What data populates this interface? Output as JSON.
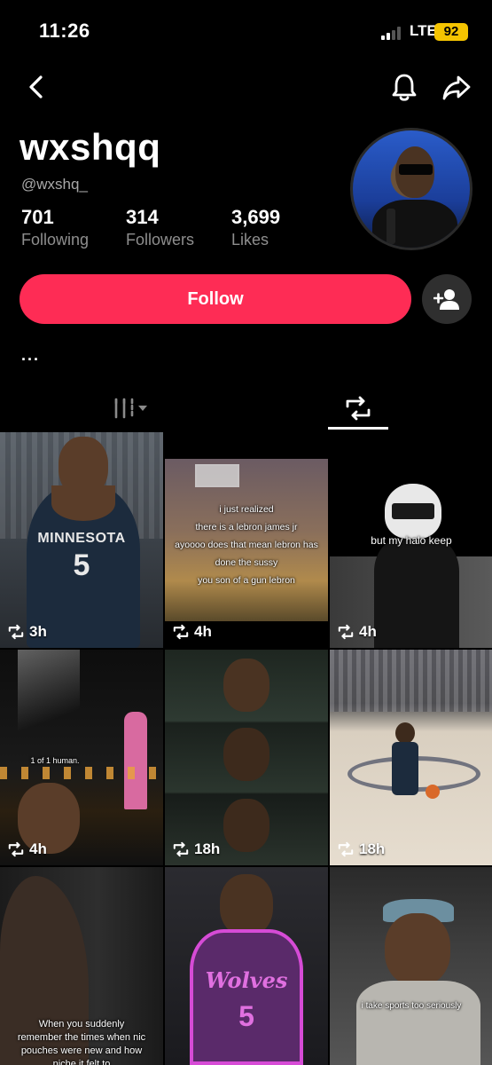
{
  "status_bar": {
    "time": "11:26",
    "network": "LTE",
    "battery": "92"
  },
  "profile": {
    "display_name": "wxshqq",
    "username": "@wxshq_",
    "stats": [
      {
        "value": "701",
        "label": "Following"
      },
      {
        "value": "314",
        "label": "Followers"
      },
      {
        "value": "3,699",
        "label": "Likes"
      }
    ],
    "follow_label": "Follow",
    "bio": "..."
  },
  "videos": [
    {
      "time": "3h",
      "caption": ""
    },
    {
      "time": "4h",
      "caption": "i just realized\nthere is a lebron james jr\nayoooo does that mean lebron has done the sussy\nyou son of a gun lebron"
    },
    {
      "time": "4h",
      "caption": "but my halo keep"
    },
    {
      "time": "4h",
      "caption": "1 of 1 human."
    },
    {
      "time": "18h",
      "caption": ""
    },
    {
      "time": "18h",
      "caption": ""
    },
    {
      "time": "",
      "caption": "When you suddenly remember the times when nic pouches were new and how niche it felt to"
    },
    {
      "time": "",
      "caption": ""
    },
    {
      "time": "",
      "caption": "i take sports too seriously"
    }
  ],
  "tile_text": {
    "jersey1_team": "MINNESOTA",
    "jersey1_number": "5",
    "jersey2_team": "Wolves",
    "jersey2_number": "5"
  },
  "colors": {
    "accent": "#fe2c55",
    "background": "#000000",
    "battery": "#f5c400"
  },
  "icons": [
    "back-arrow-icon",
    "bell-icon",
    "share-icon",
    "add-user-icon",
    "grid-icon",
    "repost-icon"
  ]
}
